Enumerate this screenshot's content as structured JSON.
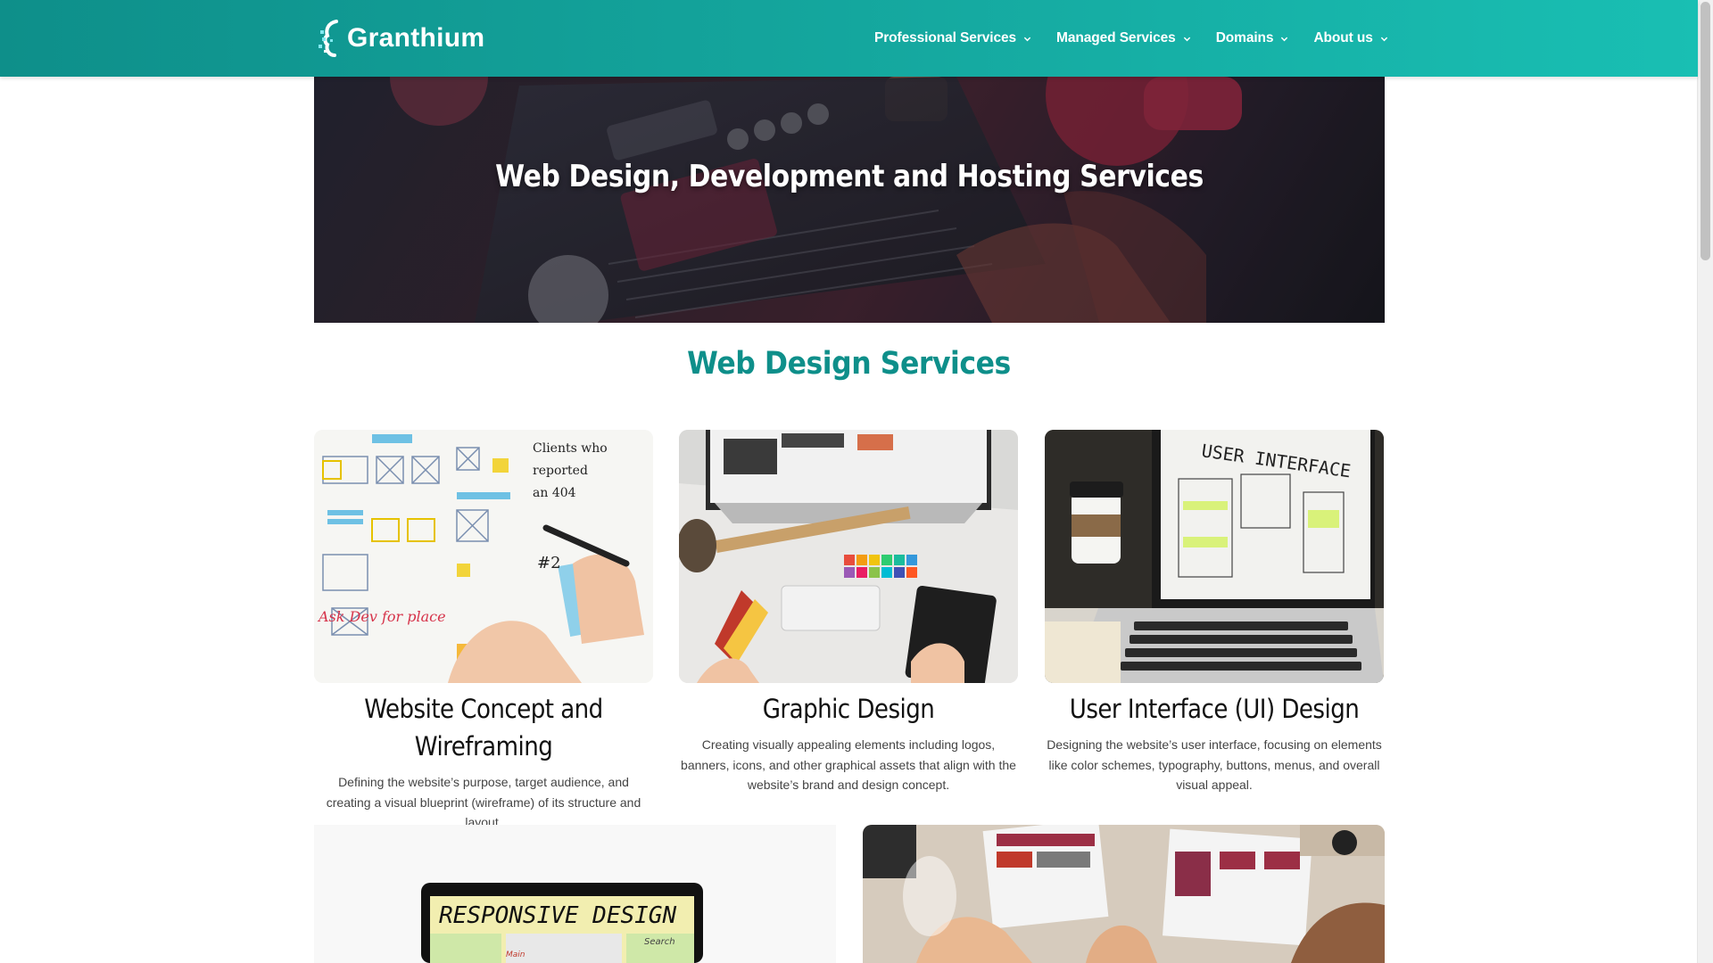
{
  "header": {
    "brand": "Granthium",
    "nav": [
      {
        "label": "Professional Services"
      },
      {
        "label": "Managed Services"
      },
      {
        "label": "Domains"
      },
      {
        "label": "About us"
      }
    ]
  },
  "hero": {
    "title": "Web Design, Development and Hosting Services"
  },
  "section": {
    "title": "Web Design Services"
  },
  "cards": [
    {
      "title": "Website Concept and Wireframing",
      "desc": "Defining the website’s purpose, target audience, and creating a visual blueprint (wireframe) of its structure and layout."
    },
    {
      "title": "Graphic Design",
      "desc": "Creating visually appealing elements including logos, banners, icons, and other graphical assets that align with the website’s brand and design concept."
    },
    {
      "title": "User Interface (UI) Design",
      "desc": "Designing the website’s user interface, focusing on elements like color schemes, typography, buttons, menus, and overall visual appeal."
    }
  ],
  "bottom_images": {
    "left_caption": "RESPONSIVE DESIGN",
    "left_search": "Search",
    "left_main": "Main"
  },
  "colors": {
    "header_start": "#0e8f8a",
    "header_end": "#19bfb3",
    "accent": "#0e8f8a"
  }
}
